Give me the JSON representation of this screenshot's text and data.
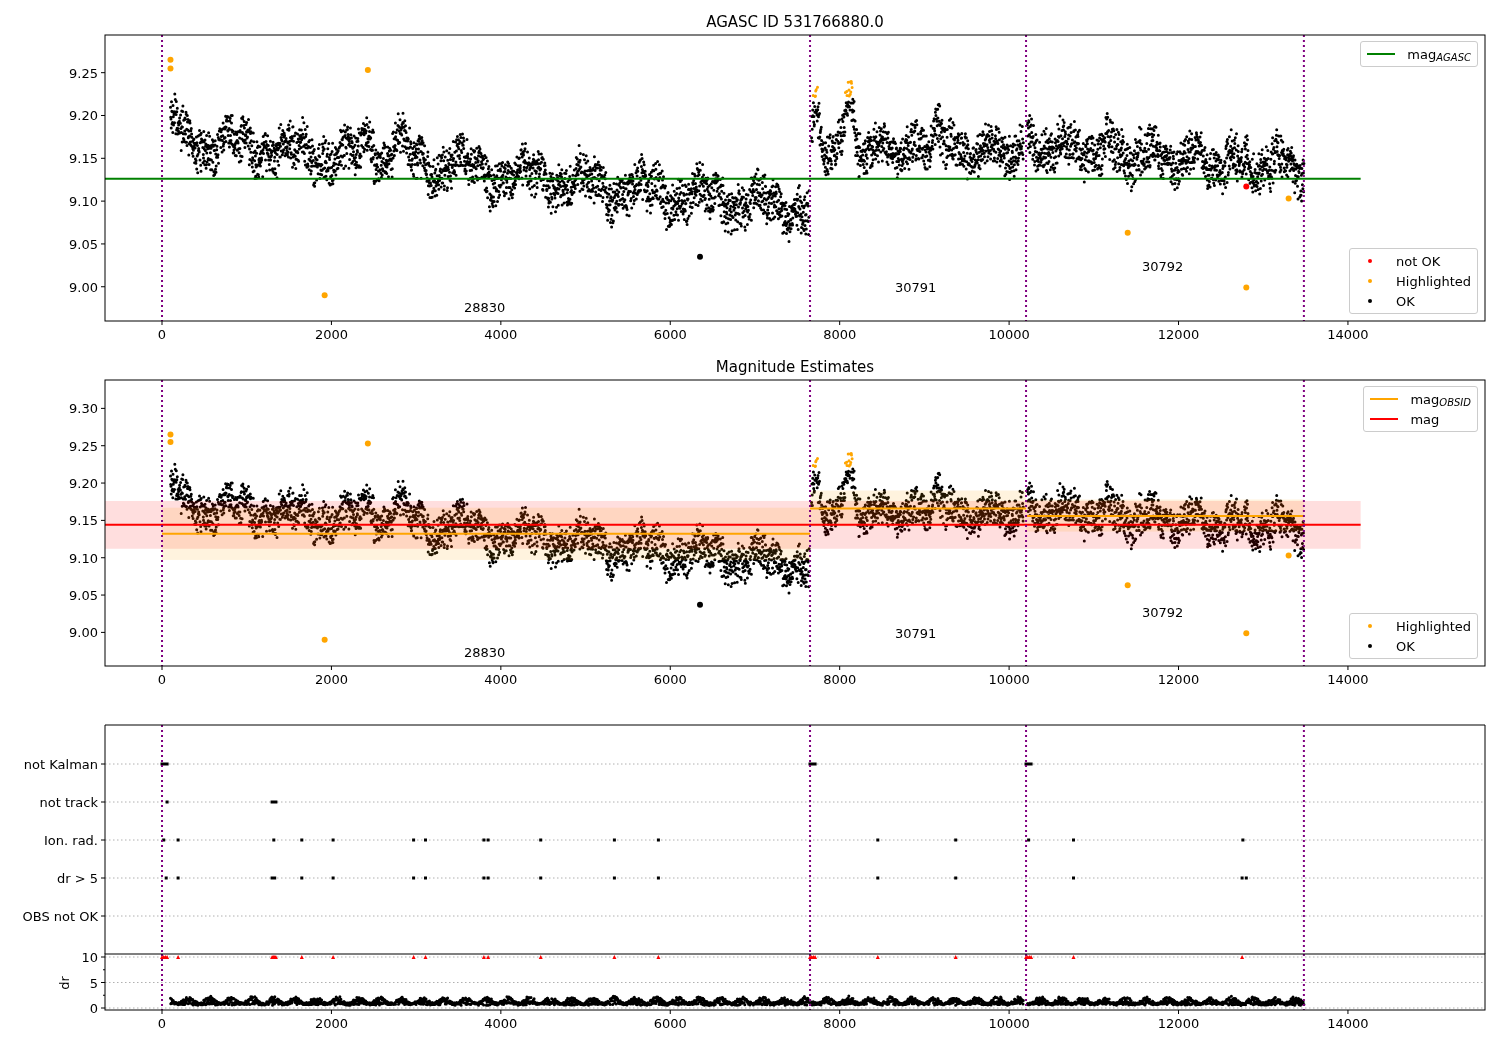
{
  "magnitude_panels": [
    {
      "chart_data": {
        "type": "scatter",
        "title": "AGASC ID 531766880.0",
        "xlim": [
          -673,
          15618
        ],
        "ylim": [
          8.96,
          9.294
        ],
        "xticks": [
          {
            "value": 0,
            "label": "0"
          },
          {
            "value": 2000,
            "label": "2000"
          },
          {
            "value": 4000,
            "label": "4000"
          },
          {
            "value": 6000,
            "label": "6000"
          },
          {
            "value": 8000,
            "label": "8000"
          },
          {
            "value": 10000,
            "label": "10000"
          },
          {
            "value": 12000,
            "label": "12000"
          },
          {
            "value": 14000,
            "label": "14000"
          }
        ],
        "yticks": [
          {
            "value": 9.0,
            "label": "9.00"
          },
          {
            "value": 9.05,
            "label": "9.05"
          },
          {
            "value": 9.1,
            "label": "9.10"
          },
          {
            "value": 9.15,
            "label": "9.15"
          },
          {
            "value": 9.2,
            "label": "9.20"
          },
          {
            "value": 9.25,
            "label": "9.25"
          }
        ],
        "series": [
          {
            "name": "not OK",
            "color": "#ff0000",
            "x": [
              12800
            ],
            "values": [
              9.117
            ]
          },
          {
            "name": "Highlighted",
            "color": "#ffa500",
            "x": [
              100,
              100,
              2430,
              1920,
              11400,
              12800,
              13300
            ],
            "values": [
              9.265,
              9.255,
              9.253,
              8.99,
              9.063,
              8.999,
              9.103
            ]
          },
          {
            "name": "OK",
            "color": "#000000",
            "x": [
              6351
            ],
            "values": [
              9.035
            ]
          }
        ],
        "ref_lines": [
          {
            "axis": "y",
            "value": 9.126,
            "color": "#008000",
            "label": "mag$_{AGASC}$"
          },
          {
            "axis": "x",
            "value": 0,
            "color": "#800080"
          },
          {
            "axis": "x",
            "value": 7650,
            "color": "#800080"
          },
          {
            "axis": "x",
            "value": 10200,
            "color": "#800080"
          },
          {
            "axis": "x",
            "value": 13480,
            "color": "#800080"
          }
        ],
        "annotations": [
          "28830",
          "30791",
          "30792"
        ]
      }
    },
    {
      "chart_data": {
        "type": "scatter",
        "title": "Magnitude Estimates",
        "xlim": [
          -673,
          15618
        ],
        "ylim": [
          8.955,
          9.338
        ],
        "xticks": [
          {
            "value": 0,
            "label": "0"
          },
          {
            "value": 2000,
            "label": "2000"
          },
          {
            "value": 4000,
            "label": "4000"
          },
          {
            "value": 6000,
            "label": "6000"
          },
          {
            "value": 8000,
            "label": "8000"
          },
          {
            "value": 10000,
            "label": "10000"
          },
          {
            "value": 12000,
            "label": "12000"
          },
          {
            "value": 14000,
            "label": "14000"
          }
        ],
        "yticks": [
          {
            "value": 9.0,
            "label": "9.00"
          },
          {
            "value": 9.05,
            "label": "9.05"
          },
          {
            "value": 9.1,
            "label": "9.10"
          },
          {
            "value": 9.15,
            "label": "9.15"
          },
          {
            "value": 9.2,
            "label": "9.20"
          },
          {
            "value": 9.25,
            "label": "9.25"
          },
          {
            "value": 9.3,
            "label": "9.30"
          }
        ],
        "series": [
          {
            "name": "Highlighted",
            "color": "#ffa500",
            "x": [
              100,
              100,
              2430,
              1920,
              11400,
              12800,
              13300
            ],
            "values": [
              9.265,
              9.255,
              9.253,
              8.99,
              9.063,
              8.999,
              9.103
            ]
          },
          {
            "name": "OK",
            "color": "#000000",
            "x": [
              6351
            ],
            "values": [
              9.037
            ]
          }
        ],
        "bands": [
          {
            "axis": "y",
            "from": 9.112,
            "to": 9.176,
            "color": "#ff0000"
          },
          {
            "axis": "y",
            "from": 9.097,
            "to": 9.167,
            "color": "#ffa500"
          },
          {
            "axis": "y",
            "from": 9.142,
            "to": 9.19,
            "color": "#ffa500"
          },
          {
            "axis": "y",
            "from": 9.135,
            "to": 9.178,
            "color": "#ffa500"
          }
        ],
        "ref_lines": [
          {
            "axis": "y",
            "value": 9.132,
            "color": "#ffa500",
            "label": "mag$_{OBSID}$"
          },
          {
            "axis": "y",
            "value": 9.166,
            "color": "#ffa500"
          },
          {
            "axis": "y",
            "value": 9.156,
            "color": "#ffa500"
          },
          {
            "axis": "y",
            "value": 9.144,
            "color": "#ff0000",
            "label": "mag"
          },
          {
            "axis": "x",
            "value": 0,
            "color": "#800080"
          },
          {
            "axis": "x",
            "value": 7650,
            "color": "#800080"
          },
          {
            "axis": "x",
            "value": 10200,
            "color": "#800080"
          },
          {
            "axis": "x",
            "value": 13480,
            "color": "#800080"
          }
        ],
        "annotations": [
          "28830",
          "30791",
          "30792"
        ]
      }
    }
  ],
  "flags_panel": {
    "rows": [
      {
        "label": "not Kalman"
      },
      {
        "label": "not track"
      },
      {
        "label": "Ion. rad."
      },
      {
        "label": "dr > 5"
      },
      {
        "label": "OBS not OK"
      }
    ]
  },
  "dr_panel": {
    "chart_data": {
      "type": "scatter",
      "ylabel": "dr",
      "xlim": [
        -673,
        15618
      ],
      "ylim": [
        -0.39,
        10.59
      ],
      "xticks": [
        {
          "value": 0,
          "label": "0"
        },
        {
          "value": 2000,
          "label": "2000"
        },
        {
          "value": 4000,
          "label": "4000"
        },
        {
          "value": 6000,
          "label": "6000"
        },
        {
          "value": 8000,
          "label": "8000"
        },
        {
          "value": 10000,
          "label": "10000"
        },
        {
          "value": 12000,
          "label": "12000"
        },
        {
          "value": 14000,
          "label": "14000"
        }
      ],
      "yticks": [
        {
          "value": 0,
          "label": "0"
        },
        {
          "value": 5,
          "label": "5"
        },
        {
          "value": 10,
          "label": "10"
        }
      ],
      "series": [
        {
          "color": "#ff0000",
          "x": [
            0,
            20,
            40,
            60,
            190,
            1300,
            1315,
            1330,
            1345,
            1650,
            2020,
            2970,
            3110,
            3800,
            3850,
            4470,
            5340,
            5860,
            7650,
            7670,
            7690,
            7710,
            8450,
            9370,
            10200,
            10220,
            10240,
            10260,
            10760,
            12750
          ],
          "values": [
            10,
            10,
            10,
            10,
            10,
            10,
            10,
            10,
            10,
            10,
            10,
            10,
            10,
            10,
            10,
            10,
            10,
            10,
            10,
            10,
            10,
            10,
            10,
            10,
            10,
            10,
            10,
            10,
            10,
            10
          ]
        }
      ],
      "ref_lines": [
        {
          "axis": "x",
          "value": 0,
          "color": "#800080"
        },
        {
          "axis": "x",
          "value": 7650,
          "color": "#800080"
        },
        {
          "axis": "x",
          "value": 10200,
          "color": "#800080"
        },
        {
          "axis": "x",
          "value": 13480,
          "color": "#800080"
        }
      ]
    }
  }
}
